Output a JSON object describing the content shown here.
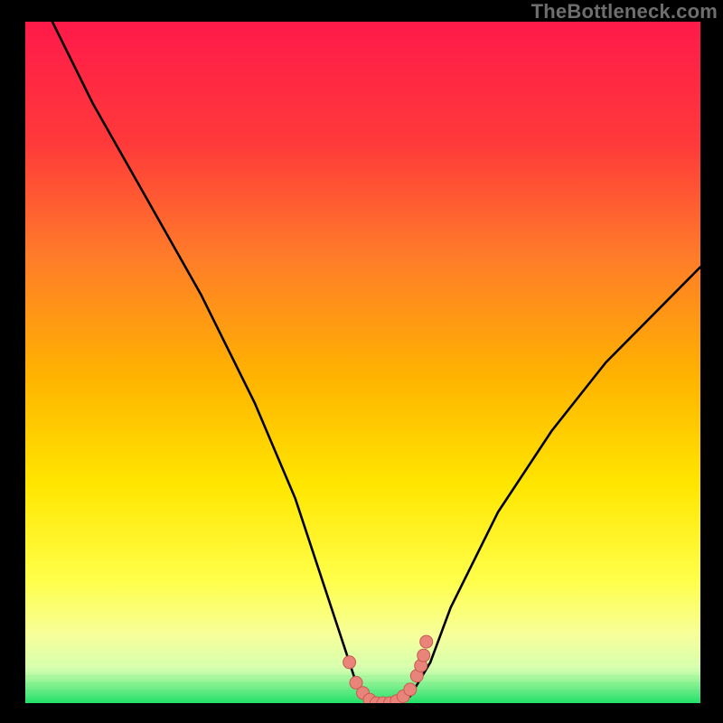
{
  "watermark": "TheBottleneck.com",
  "colors": {
    "gradient_top": "#ff1a4a",
    "gradient_mid_upper": "#ff6a2a",
    "gradient_mid": "#ffd400",
    "gradient_lower": "#f7ff66",
    "gradient_band": "#e8ffb0",
    "gradient_bottom": "#22e06a",
    "curve": "#000000",
    "marker_fill": "#e9847a",
    "marker_stroke": "#c85a50",
    "background": "#000000"
  },
  "chart_data": {
    "type": "line",
    "title": "",
    "xlabel": "",
    "ylabel": "",
    "xlim": [
      0,
      100
    ],
    "ylim": [
      0,
      100
    ],
    "series": [
      {
        "name": "bottleneck-curve",
        "x_pct": [
          4,
          10,
          18,
          26,
          34,
          40,
          44,
          47,
          49,
          51,
          53,
          55,
          57,
          60,
          63,
          70,
          78,
          86,
          94,
          100
        ],
        "y_pct": [
          100,
          88,
          74,
          60,
          44,
          30,
          18,
          9,
          3,
          0,
          0,
          0,
          1,
          6,
          14,
          28,
          40,
          50,
          58,
          64
        ]
      }
    ],
    "markers": {
      "name": "optimal-range",
      "points_pct": [
        [
          48,
          6
        ],
        [
          49,
          3
        ],
        [
          50,
          1.5
        ],
        [
          51,
          0.5
        ],
        [
          52,
          0
        ],
        [
          53,
          0
        ],
        [
          54,
          0
        ],
        [
          55,
          0.3
        ],
        [
          56,
          1
        ],
        [
          57,
          2
        ],
        [
          58,
          4
        ],
        [
          58.6,
          5.5
        ],
        [
          59,
          7
        ],
        [
          59.4,
          9
        ]
      ]
    }
  }
}
